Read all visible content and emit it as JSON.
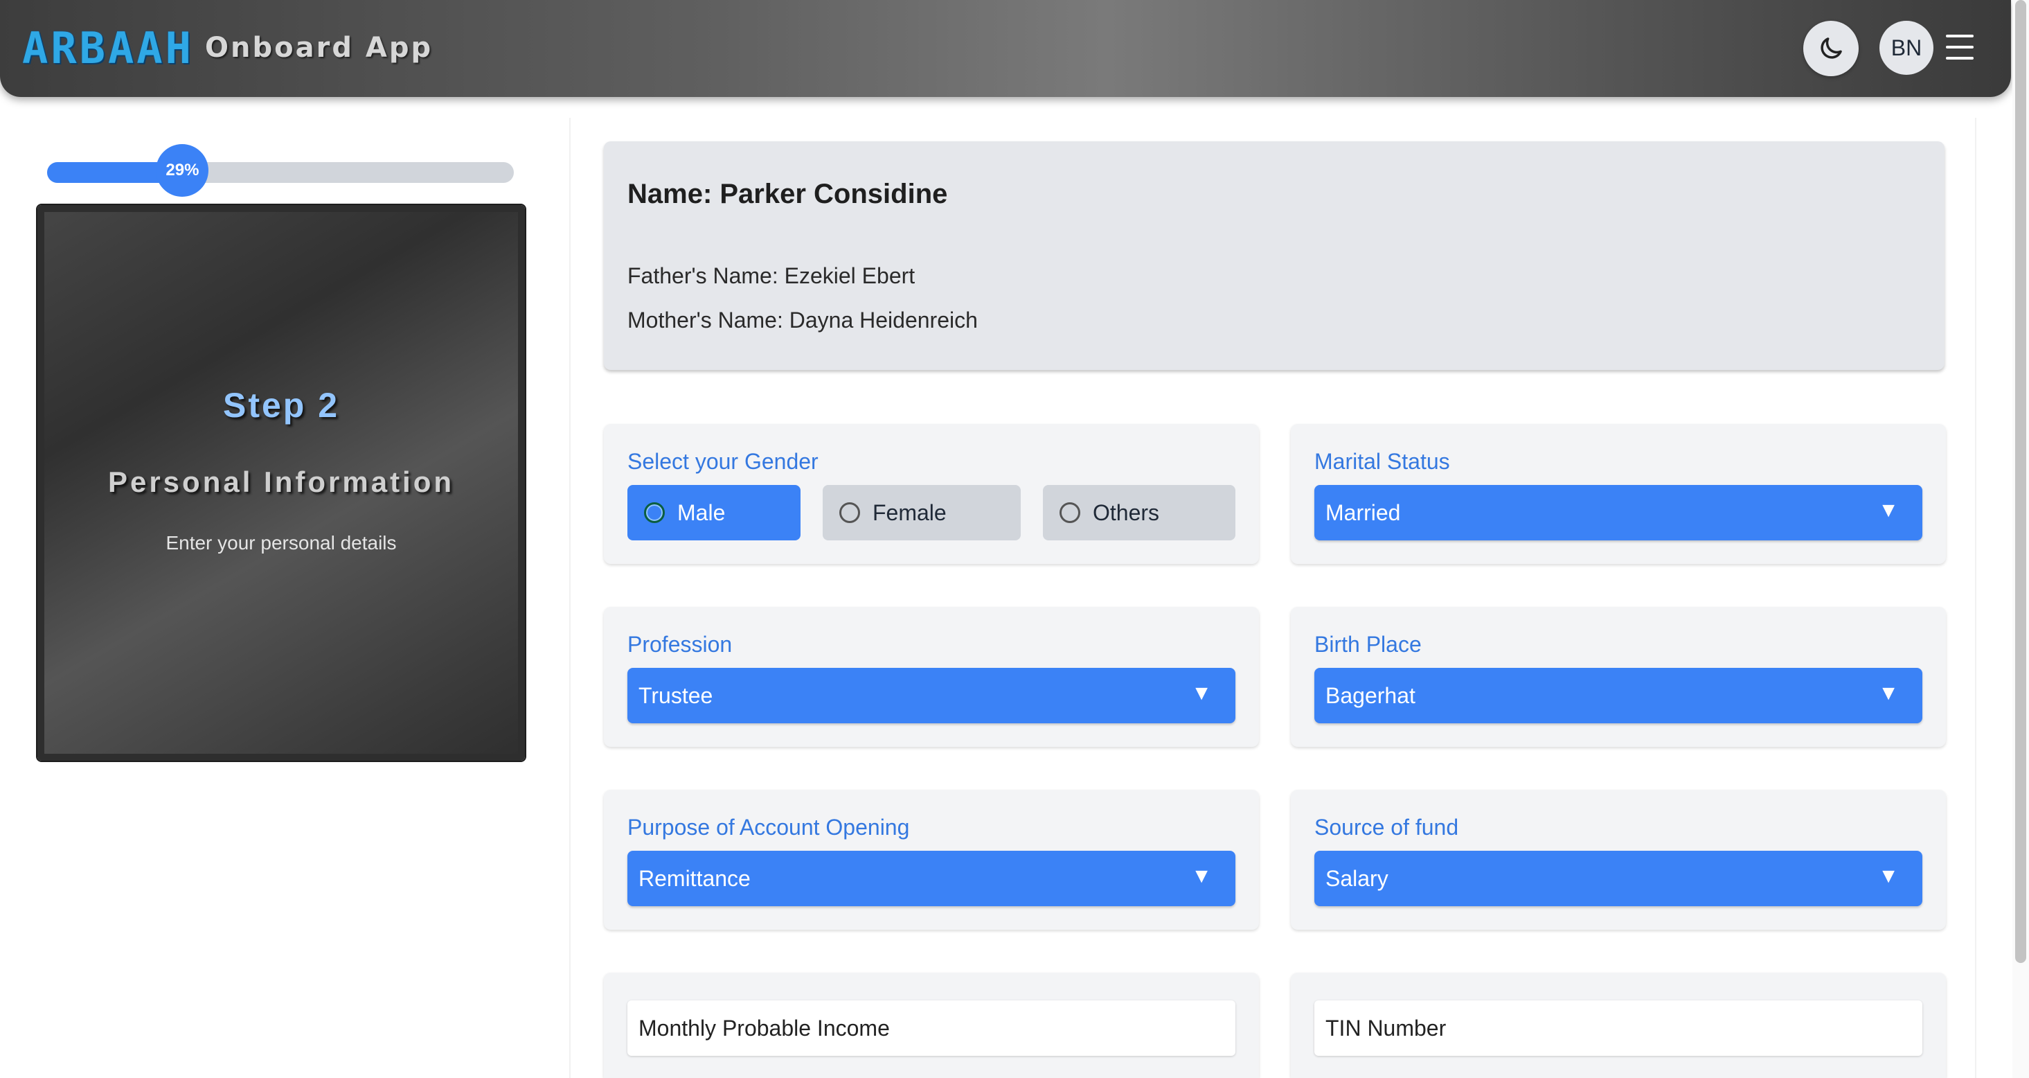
{
  "header": {
    "logo_text": "ARBAAH",
    "app_title": "Onboard App",
    "language_label": "BN",
    "theme_icon": "moon-icon",
    "menu_icon": "hamburger-menu-icon"
  },
  "progress": {
    "percent": 29,
    "label": "29%"
  },
  "step": {
    "number": "Step 2",
    "title": "Personal Information",
    "subtitle": "Enter your personal details"
  },
  "info": {
    "name": "Name: Parker Considine",
    "father": "Father's Name: Ezekiel Ebert",
    "mother": "Mother's Name: Dayna Heidenreich"
  },
  "gender": {
    "label": "Select your Gender",
    "options": [
      "Male",
      "Female",
      "Others"
    ],
    "selected": "Male"
  },
  "marital_status": {
    "label": "Marital Status",
    "value": "Married"
  },
  "profession": {
    "label": "Profession",
    "value": "Trustee"
  },
  "birth_place": {
    "label": "Birth Place",
    "value": "Bagerhat"
  },
  "purpose": {
    "label": "Purpose of Account Opening",
    "value": "Remittance"
  },
  "source_of_fund": {
    "label": "Source of fund",
    "value": "Salary"
  },
  "monthly_income": {
    "placeholder": "Monthly Probable Income"
  },
  "tin_number": {
    "placeholder": "TIN Number"
  },
  "colors": {
    "accent": "#3b82f6",
    "label_blue": "#3478e0",
    "card_bg": "#f3f4f6"
  },
  "select_arrow": "▼"
}
